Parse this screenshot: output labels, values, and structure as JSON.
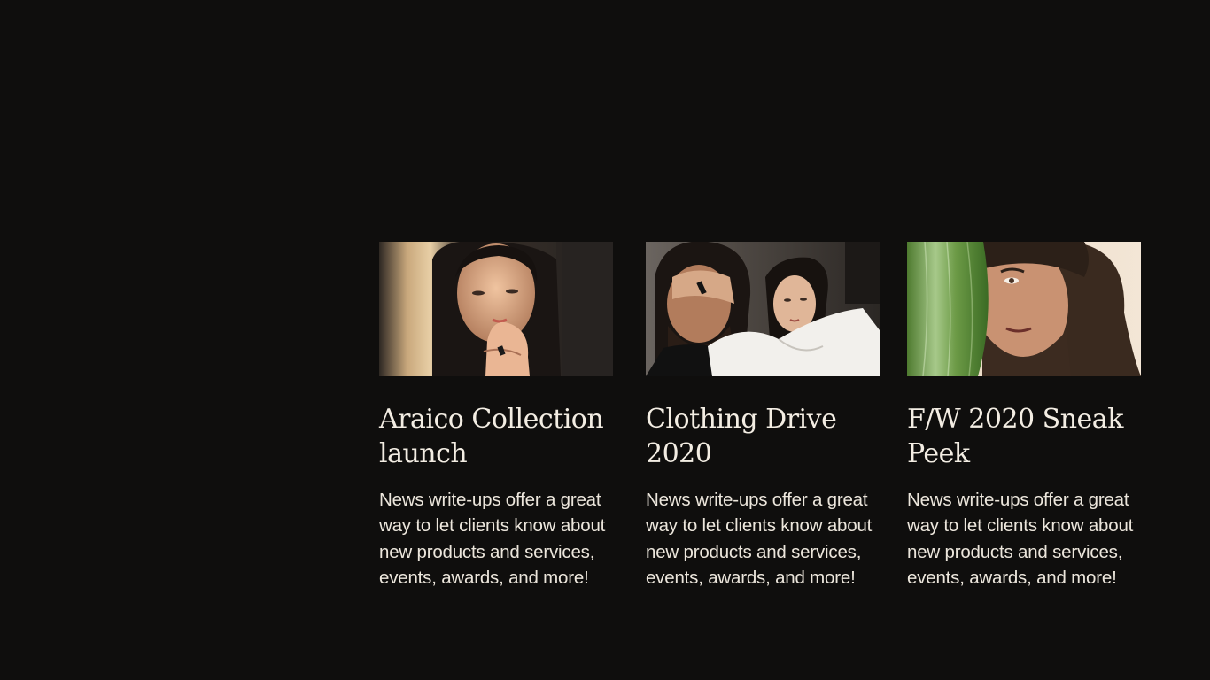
{
  "posts": [
    {
      "title": "Araico Collection launch",
      "body": "News write-ups offer a great way to let clients know about new products and services, events, awards, and more!",
      "image": "woman-portrait-hand-on-lips"
    },
    {
      "title": "Clothing Drive 2020",
      "body": "News write-ups offer a great way to let clients know about new products and services, events, awards, and more!",
      "image": "couple-portrait-hand-over-eyes"
    },
    {
      "title": "F/W 2020 Sneak Peek",
      "body": "News write-ups offer a great way to let clients know about new products and services, events, awards, and more!",
      "image": "man-portrait-behind-leaf"
    }
  ],
  "colors": {
    "background": "#0f0e0d",
    "text": "#f3ede3"
  }
}
